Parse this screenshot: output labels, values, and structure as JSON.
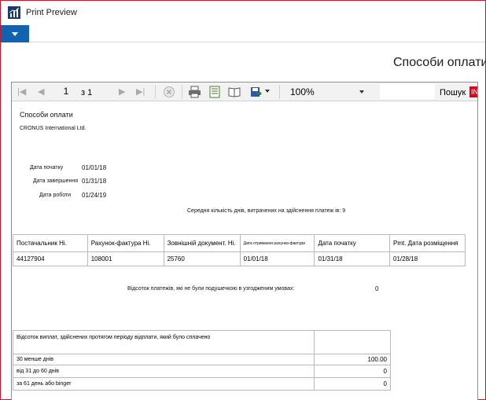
{
  "window": {
    "title": "Print Preview",
    "icon": "chart-app-icon"
  },
  "header": {
    "title": "Способи оплати"
  },
  "toolbar": {
    "page_current": "1",
    "page_of": "з 1",
    "zoom": "100%",
    "search_label": "Пошук",
    "search_badge": "IN"
  },
  "report": {
    "title": "Способи оплати",
    "company": "CRONUS International Ltd.",
    "params": [
      {
        "label": "Дата початку",
        "value": "01/01/18"
      },
      {
        "label": "Дата завершення",
        "value": "01/31/18"
      },
      {
        "label": "Дата роботи",
        "value": "01/24/19"
      }
    ],
    "avg_days_text": "Середня кількість днів, витрачених на здійснення платеж ів: 9",
    "columns": [
      "Постачальник Ні.",
      "Рахунок-фактура Ні.",
      "Зовнішній документ. Ні.",
      "Дата отримання рахунка-фактури",
      "Дата початку",
      "Pmt. Дата розміщення"
    ],
    "row": [
      "44127904",
      "108001",
      "25760",
      "01/01/18",
      "01/31/18",
      "01/28/18"
    ],
    "pct_not_extended_label": "Відсоток платежів, які не були подушечкою в узгодженим умовах:",
    "pct_not_extended_value": "0",
    "paid_table": {
      "header": "Відсоток виплат, здійснених протягом періоду відплати, який було сплачено",
      "rows": [
        {
          "label": "30 менше днів",
          "value": "100.00"
        },
        {
          "label": "від 31 до 60 днів",
          "value": "0"
        },
        {
          "label": "за 61 день або binger",
          "value": "0"
        }
      ]
    }
  }
}
